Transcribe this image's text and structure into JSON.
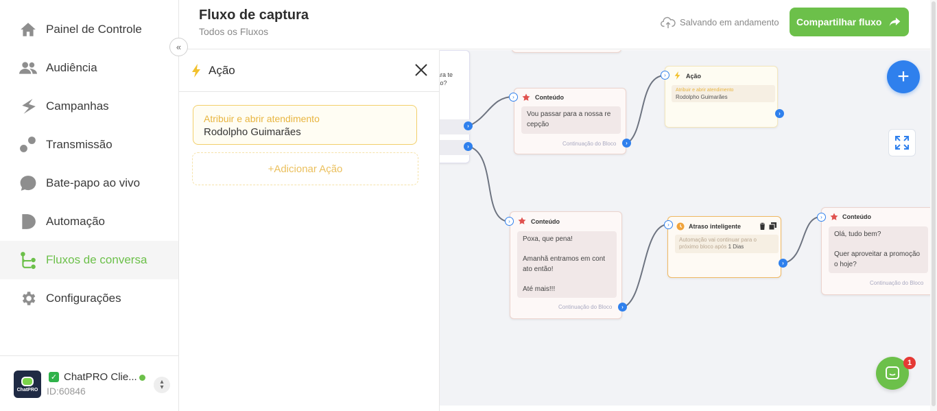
{
  "sidebar": {
    "items": [
      {
        "label": "Painel de Controle",
        "icon": "home-icon"
      },
      {
        "label": "Audiência",
        "icon": "users-icon"
      },
      {
        "label": "Campanhas",
        "icon": "campaign-icon"
      },
      {
        "label": "Transmissão",
        "icon": "broadcast-icon"
      },
      {
        "label": "Bate-papo ao vivo",
        "icon": "chat-icon"
      },
      {
        "label": "Automação",
        "icon": "automation-icon"
      },
      {
        "label": "Fluxos de conversa",
        "icon": "flow-icon",
        "active": true
      },
      {
        "label": "Configurações",
        "icon": "gear-icon"
      }
    ],
    "account": {
      "name": "ChatPRO Clie...",
      "id": "ID:60846",
      "avatar_text": "ChatPRO"
    }
  },
  "header": {
    "title": "Fluxo de captura",
    "breadcrumb": "Todos os Fluxos",
    "save_status": "Salvando em andamento",
    "share_label": "Compartilhar fluxo"
  },
  "panel": {
    "title": "Ação",
    "action_label": "Atribuir e abrir atendimento",
    "action_value": "Rodolpho Guimarães",
    "add_action": "+Adicionar Ação"
  },
  "canvas": {
    "partial_text_1": "para te",
    "partial_text_2": "ção?",
    "nodes": {
      "content1": {
        "title": "Conteúdo",
        "message": "Vou passar para a nossa re cepção",
        "footer": "Continuação do Bloco"
      },
      "action1": {
        "title": "Ação",
        "label": "Atribuir e abrir atendimento",
        "value": "Rodolpho Guimarães"
      },
      "content2": {
        "title": "Conteúdo",
        "message": "Poxa, que pena!\n\nAmanhã entramos em cont ato então!\n\nAté mais!!!",
        "footer": "Continuação do Bloco"
      },
      "delay1": {
        "title": "Atraso inteligente",
        "text": "Automação vai continuar para o próximo bloco após",
        "duration": "1 Dias"
      },
      "content3": {
        "title": "Conteúdo",
        "message": "Olá, tudo bem?\n\nQuer aproveitar a promoção o hoje?",
        "footer": "Continuação do Bloco"
      }
    },
    "chat_badge": "1"
  },
  "colors": {
    "brand_green": "#6cc04a",
    "accent_blue": "#2f80ed",
    "star_red": "#e0524f",
    "action_yellow": "#f2c12e"
  }
}
